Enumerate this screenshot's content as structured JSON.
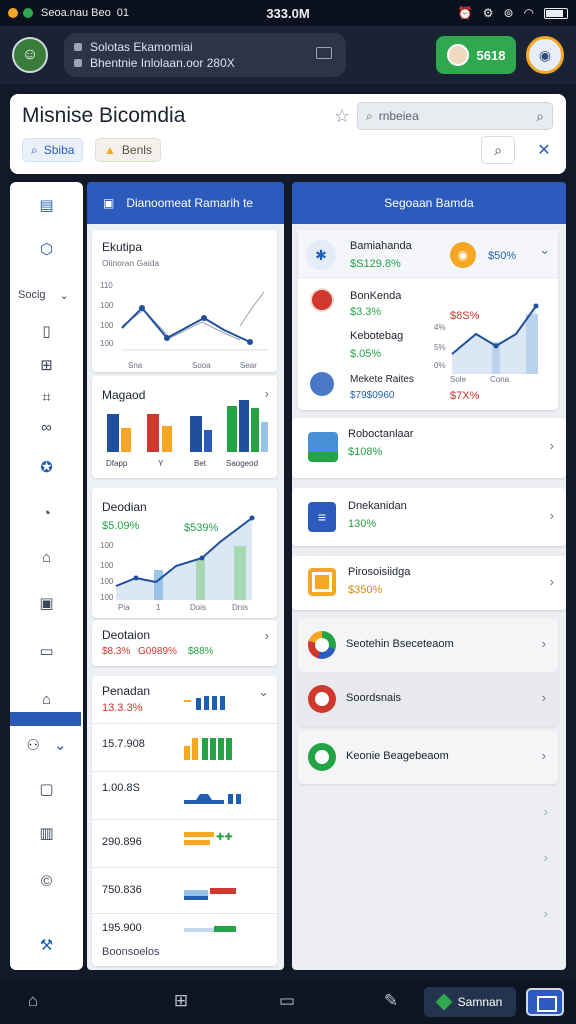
{
  "status_bar": {
    "app_label": "Seoa.nau Beo",
    "counter": "01",
    "time": "333.0M"
  },
  "top_bar": {
    "notification_line1": "Solotas Ekamomiai",
    "notification_line2": "Bhentnie Inlolaan.oor 280X",
    "green_button_label": "5618"
  },
  "header": {
    "title": "Misnise Bicomdia",
    "search_placeholder": "rnbeiea",
    "chip1": "Sbiba",
    "chip2": "Benls"
  },
  "sidebar": {
    "section_label": "Socig"
  },
  "col1": {
    "header": "Dianoomeat  Ramarih te",
    "card1": {
      "title": "Ekutipa",
      "subtitle": "Oiinoran Gaida",
      "y_ticks": [
        "110",
        "100",
        "100",
        "100"
      ],
      "x_ticks": [
        "Sna",
        "Sooa",
        "Sear"
      ]
    },
    "card2": {
      "title": "Magaod",
      "x_ticks": [
        "Dfapp",
        "Y",
        "Bet",
        "Saogeod"
      ]
    },
    "card3": {
      "title": "Deodian",
      "value1": "$5.09%",
      "value2": "$539%",
      "y_ticks": [
        "100",
        "100",
        "100",
        "100"
      ],
      "x_ticks": [
        "Pia",
        "1",
        "Dois",
        "Dnis"
      ]
    },
    "card4": {
      "title": "Deotaion",
      "value1": "$8.3%",
      "value2": "G0989%",
      "value3": "$88%"
    },
    "list": {
      "title": "Penadan",
      "rows": [
        {
          "value": "13.3.3%"
        },
        {
          "value": "15.7.908"
        },
        {
          "value": "1.00.8S"
        },
        {
          "value": "290.896"
        },
        {
          "value": "750.836"
        },
        {
          "value": "195.900"
        }
      ],
      "footer": "Boonsoelos"
    }
  },
  "col2": {
    "header": "Segoaan Bamda",
    "card1": {
      "row1_title": "Bamiahanda",
      "row1_value": "$S129.8%",
      "row1_badge": "$50%",
      "row2_title": "BonKenda",
      "row2_value": "$3.3%",
      "row2_right": "$8S%",
      "row3_title": "Kebotebag",
      "row3_value": "$.05%",
      "row4_title": "Mekete Raites",
      "row4_value": "$79$0960",
      "row4_right": "$7X%",
      "chart_ticks": [
        "4%",
        "5%",
        "0%"
      ],
      "chart_x": [
        "Sole",
        "Cona"
      ]
    },
    "cards": [
      {
        "title": "Roboctanlaar",
        "value": "$108%"
      },
      {
        "title": "Dnekanidan",
        "value": "130%"
      },
      {
        "title": "Pirosoisiidga",
        "value": "$350%"
      }
    ],
    "rows": [
      {
        "label": "Seotehin Bseceteaom"
      },
      {
        "label": "Soordsnais"
      },
      {
        "label": "Keonie Beagebeaom"
      }
    ]
  },
  "bottom_bar": {
    "save_label": "Samnan"
  },
  "colors": {
    "accent": "#2c5bbd",
    "green": "#22a344",
    "red": "#d0382e",
    "orange": "#f5a623"
  }
}
